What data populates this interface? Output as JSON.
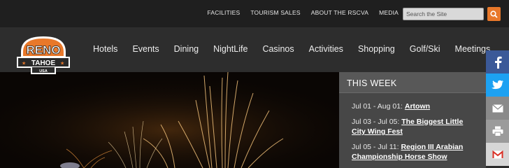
{
  "header": {
    "top_links": [
      "FACILITIES",
      "TOURISM SALES",
      "ABOUT THE RSCVA",
      "MEDIA"
    ],
    "search": {
      "placeholder": "Search the Site"
    }
  },
  "logo": {
    "line1": "RENO",
    "line2": "TAHOE",
    "line3": "USA"
  },
  "nav": {
    "items": [
      "Hotels",
      "Events",
      "Dining",
      "NightLife",
      "Casinos",
      "Activities",
      "Shopping",
      "Golf/Ski",
      "Meetings"
    ]
  },
  "this_week": {
    "title": "THIS WEEK",
    "events": [
      {
        "date": "Jul 01 - Aug 01:",
        "name": "Artown"
      },
      {
        "date": "Jul 03 - Jul 05:",
        "name": "The Biggest Little City Wing Fest"
      },
      {
        "date": "Jul 05 - Jul 11:",
        "name": "Region III Arabian Championship Horse Show"
      }
    ]
  },
  "share": {
    "icons": [
      "facebook-icon",
      "twitter-icon",
      "email-icon",
      "print-icon",
      "gmail-icon"
    ]
  },
  "colors": {
    "accent": "#e8782a",
    "facebook": "#3b5998",
    "twitter": "#1da1f2"
  }
}
